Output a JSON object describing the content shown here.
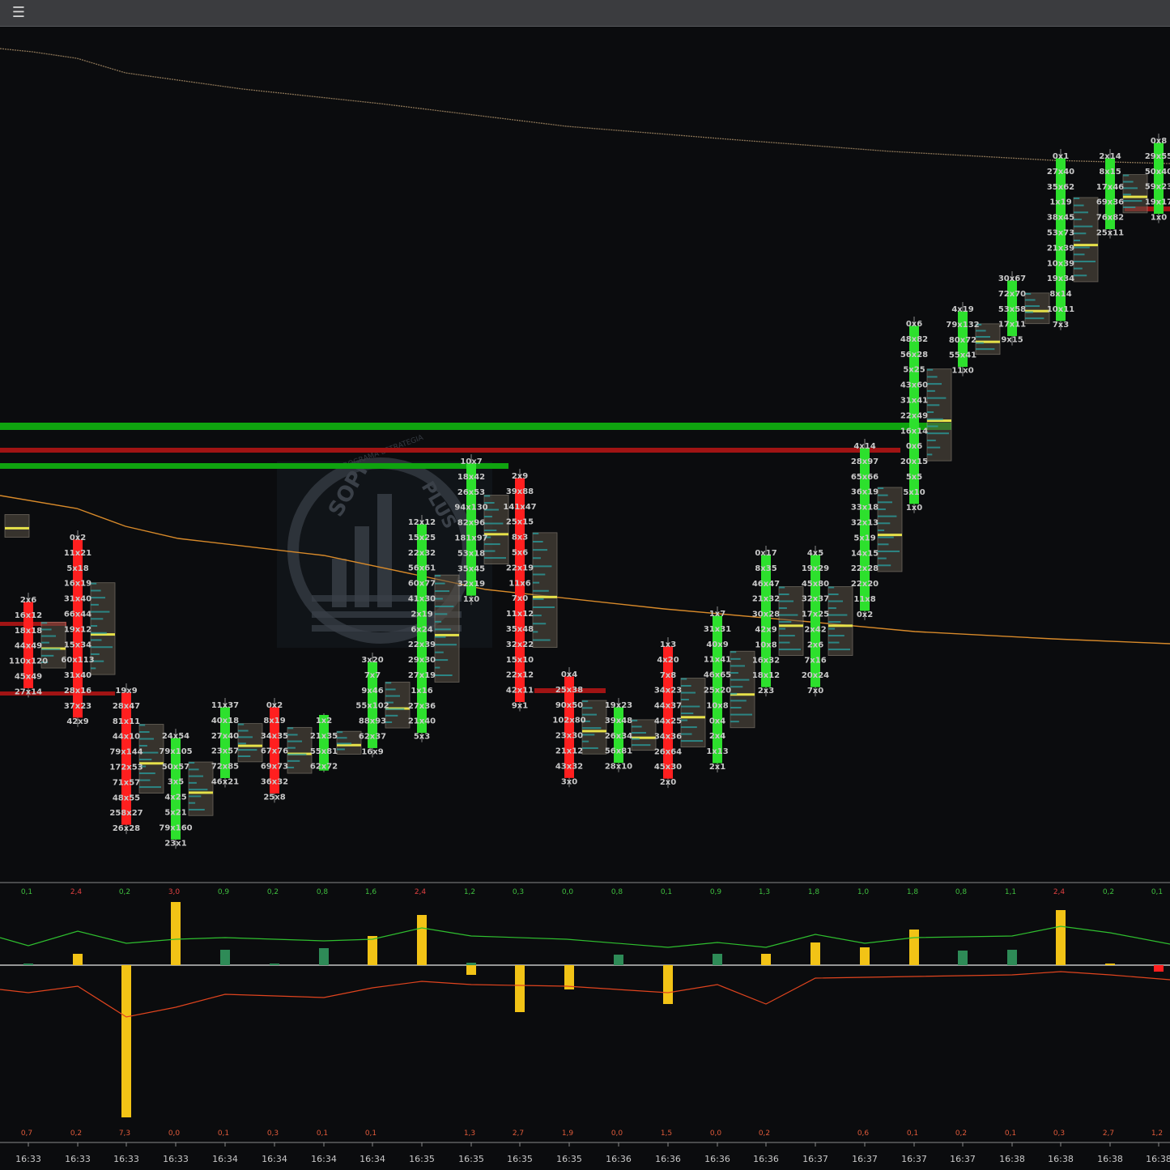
{
  "toolbar": {
    "menu_icon": "list-menu-icon"
  },
  "colors": {
    "background": "#0b0c0e",
    "bull": "#2de02d",
    "bear": "#ff1f1f",
    "box": "#5c5347",
    "poc": "#e6e14a",
    "vwap_upper": "#8a7456",
    "vwap_lower": "#d88a2a",
    "level_green": "#0fa30f",
    "level_red": "#a11414",
    "delta_bar": "#f2c316",
    "delta_bar_small": "#2e8b57",
    "delta_line_up": "#2fbf2f",
    "delta_line_down": "#e0441e",
    "watermark": "#3a4048"
  },
  "watermark": {
    "text_top": "SOPI",
    "text_right": "PLUS",
    "ring_text": "PROGRAMA ESTRATEGIA"
  },
  "chart_data": {
    "type": "footprint",
    "candles": [
      {
        "time": "16:33",
        "dir": "bull",
        "labels": []
      },
      {
        "time": "16:33",
        "dir": "bear",
        "labels": [
          "2x6",
          "16x12",
          "18x18",
          "44x49",
          "110x120",
          "45x49",
          "27x14"
        ]
      },
      {
        "time": "16:33",
        "dir": "bear",
        "labels": [
          "0x2",
          "11x21",
          "5x18",
          "16x19",
          "31x40",
          "66x44",
          "19x12",
          "15x34",
          "60x113",
          "31x40",
          "28x16",
          "37x23",
          "42x9"
        ]
      },
      {
        "time": "16:33",
        "dir": "bear",
        "labels": [
          "19x9",
          "28x47",
          "81x11",
          "44x10",
          "79x144",
          "172x53",
          "71x57",
          "48x55",
          "258x27",
          "26x28"
        ]
      },
      {
        "time": "16:33",
        "dir": "bull",
        "labels": [
          "24x54",
          "79x105",
          "50x57",
          "3x5",
          "4x25",
          "5x21",
          "79x160",
          "23x1"
        ]
      },
      {
        "time": "16:34",
        "dir": "bull",
        "labels": [
          "11x37",
          "40x18",
          "27x40",
          "23x57",
          "72x85",
          "46x21"
        ]
      },
      {
        "time": "16:34",
        "dir": "bear",
        "labels": [
          "0x2",
          "8x19",
          "34x35",
          "67x76",
          "69x73",
          "36x32",
          "25x8"
        ]
      },
      {
        "time": "16:34",
        "dir": "bull",
        "labels": [
          "1x2",
          "21x35",
          "55x81",
          "62x72"
        ]
      },
      {
        "time": "16:34",
        "dir": "bull",
        "labels": [
          "3x20",
          "7x7",
          "9x46",
          "55x102",
          "88x93",
          "62x37",
          "16x9"
        ]
      },
      {
        "time": "16:35",
        "dir": "bull",
        "labels": [
          "12x12",
          "15x25",
          "22x32",
          "56x61",
          "60x77",
          "41x30",
          "2x19",
          "6x24",
          "22x39",
          "29x30",
          "27x19",
          "1x16",
          "27x36",
          "21x40",
          "5x3"
        ]
      },
      {
        "time": "16:35",
        "dir": "bull",
        "labels": [
          "10x7",
          "18x42",
          "26x53",
          "94x130",
          "82x96",
          "181x97",
          "53x18",
          "35x45",
          "32x19",
          "1x0"
        ]
      },
      {
        "time": "16:35",
        "dir": "bear",
        "labels": [
          "2x9",
          "39x88",
          "141x47",
          "25x15",
          "8x3",
          "5x6",
          "22x19",
          "11x6",
          "7x0",
          "11x12",
          "35x48",
          "32x22",
          "15x10",
          "22x12",
          "42x11",
          "9x1"
        ]
      },
      {
        "time": "16:35",
        "dir": "bear",
        "labels": [
          "0x4",
          "25x38",
          "90x50",
          "102x80",
          "23x30",
          "21x12",
          "43x32",
          "3x0"
        ]
      },
      {
        "time": "16:36",
        "dir": "bull",
        "labels": [
          "19x23",
          "39x48",
          "26x34",
          "56x81",
          "28x10"
        ]
      },
      {
        "time": "16:36",
        "dir": "bear",
        "labels": [
          "1x3",
          "4x20",
          "7x8",
          "34x23",
          "44x37",
          "44x25",
          "34x36",
          "26x64",
          "45x30",
          "2x0"
        ]
      },
      {
        "time": "16:36",
        "dir": "bull",
        "labels": [
          "1x7",
          "31x31",
          "40x9",
          "11x41",
          "46x65",
          "25x20",
          "10x8",
          "0x4",
          "2x4",
          "1x13",
          "2x1"
        ]
      },
      {
        "time": "16:36",
        "dir": "bull",
        "labels": [
          "0x17",
          "8x35",
          "46x47",
          "21x32",
          "30x28",
          "42x9",
          "10x8",
          "16x32",
          "18x12",
          "2x3"
        ]
      },
      {
        "time": "16:37",
        "dir": "bull",
        "labels": [
          "4x5",
          "19x29",
          "45x80",
          "32x37",
          "17x25",
          "2x42",
          "2x6",
          "7x16",
          "20x24",
          "7x0"
        ]
      },
      {
        "time": "16:37",
        "dir": "bull",
        "labels": [
          "4x14",
          "28x97",
          "65x66",
          "36x19",
          "33x18",
          "32x13",
          "5x19",
          "14x15",
          "22x28",
          "22x20",
          "11x8",
          "0x2"
        ]
      },
      {
        "time": "16:37",
        "dir": "bull",
        "labels": [
          "0x6",
          "48x82",
          "56x28",
          "5x25",
          "43x60",
          "31x41",
          "22x49",
          "16x14",
          "0x6",
          "20x15",
          "5x5",
          "5x10",
          "1x0"
        ]
      },
      {
        "time": "16:37",
        "dir": "bull",
        "labels": [
          "4x19",
          "79x132",
          "80x72",
          "55x41",
          "11x0"
        ]
      },
      {
        "time": "16:38",
        "dir": "bull",
        "labels": [
          "30x67",
          "72x70",
          "53x58",
          "17x11",
          "9x15"
        ]
      },
      {
        "time": "16:38",
        "dir": "bull",
        "labels": [
          "0x1",
          "27x40",
          "35x62",
          "1x19",
          "38x45",
          "53x73",
          "21x39",
          "10x39",
          "19x34",
          "8x14",
          "10x11",
          "7x3"
        ]
      },
      {
        "time": "16:38",
        "dir": "bull",
        "labels": [
          "2x14",
          "8x15",
          "17x46",
          "69x36",
          "76x82",
          "25x11"
        ]
      },
      {
        "time": "16:38",
        "dir": "bull",
        "labels": [
          "0x8",
          "29x55",
          "50x40",
          "59x23",
          "19x17",
          "1x0"
        ]
      }
    ],
    "delta_top": [
      "0,1",
      "2,4",
      "0,2",
      "3,0",
      "0,9",
      "0,2",
      "0,8",
      "1,6",
      "2,4",
      "1,2",
      "0,3",
      "0,0",
      "0,8",
      "0,1",
      "0,9",
      "1,3",
      "1,8",
      "1,0",
      "1,8",
      "0,8",
      "1,1",
      "2,4",
      "0,2",
      "0,1"
    ],
    "delta_bottom": [
      "0,7",
      "0,2",
      "7,3",
      "0,0",
      "0,1",
      "0,3",
      "0,1",
      "0,1",
      "",
      "1,3",
      "2,7",
      "1,9",
      "0,0",
      "1,5",
      "0,0",
      "0,2",
      "",
      "0,6",
      "0,1",
      "0,2",
      "0,1",
      "0,3",
      "2,7",
      "1,2"
    ],
    "time_axis": [
      "16:33",
      "16:33",
      "16:33",
      "16:33",
      "16:34",
      "16:34",
      "16:34",
      "16:34",
      "16:35",
      "16:35",
      "16:35",
      "16:35",
      "16:36",
      "16:36",
      "16:36",
      "16:36",
      "16:37",
      "16:37",
      "16:37",
      "16:37",
      "16:38",
      "16:38",
      "16:38",
      "16:38"
    ]
  }
}
